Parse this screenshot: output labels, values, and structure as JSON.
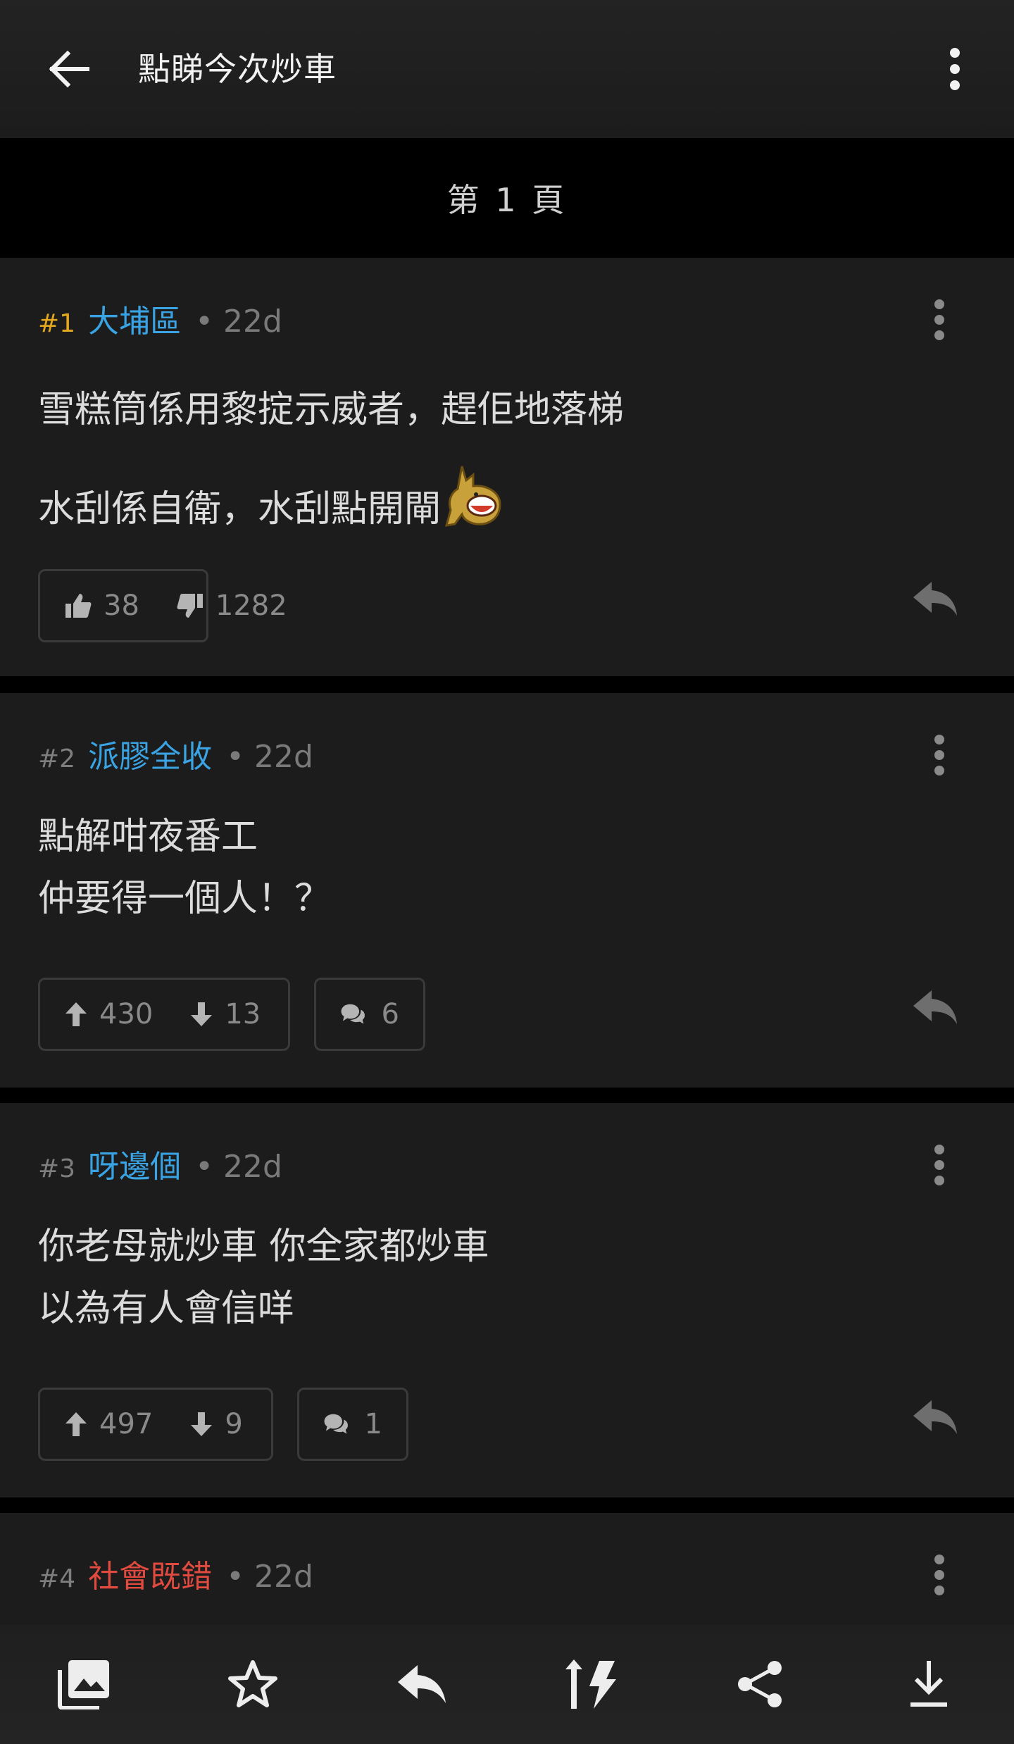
{
  "header": {
    "title": "點睇今次炒車"
  },
  "page_label": "第 1 頁",
  "posts": [
    {
      "num": "#1",
      "user": "大埔區",
      "time": "• 22d",
      "lines": [
        "雪糕筒係用黎掟示威者，趕佢地落梯",
        "水刮係自衛，水刮點開閘"
      ],
      "likes": "38",
      "dislikes": "1282",
      "vote_style": "thumbs"
    },
    {
      "num": "#2",
      "user": "派膠全收",
      "time": "• 22d",
      "lines": [
        "點解咁夜番工",
        "仲要得一個人！？"
      ],
      "likes": "430",
      "dislikes": "13",
      "comments": "6",
      "vote_style": "arrows"
    },
    {
      "num": "#3",
      "user": "呀邊個",
      "time": "• 22d",
      "lines": [
        "你老母就炒車 你全家都炒車",
        "以為有人會信咩"
      ],
      "likes": "497",
      "dislikes": "9",
      "comments": "1",
      "vote_style": "arrows"
    },
    {
      "num": "#4",
      "user": "社會既錯",
      "time": "• 22d"
    }
  ],
  "colors": {
    "op_number": "#e4a820",
    "username": "#3aa3e3",
    "username_highlight": "#e04a3f",
    "card_bg": "#1c1c1c"
  },
  "icons": {
    "topbar": [
      "back-arrow-icon",
      "more-vert-icon"
    ],
    "bottombar": [
      "gallery-icon",
      "star-icon",
      "reply-icon",
      "sort-flash-icon",
      "share-icon",
      "download-icon"
    ]
  }
}
